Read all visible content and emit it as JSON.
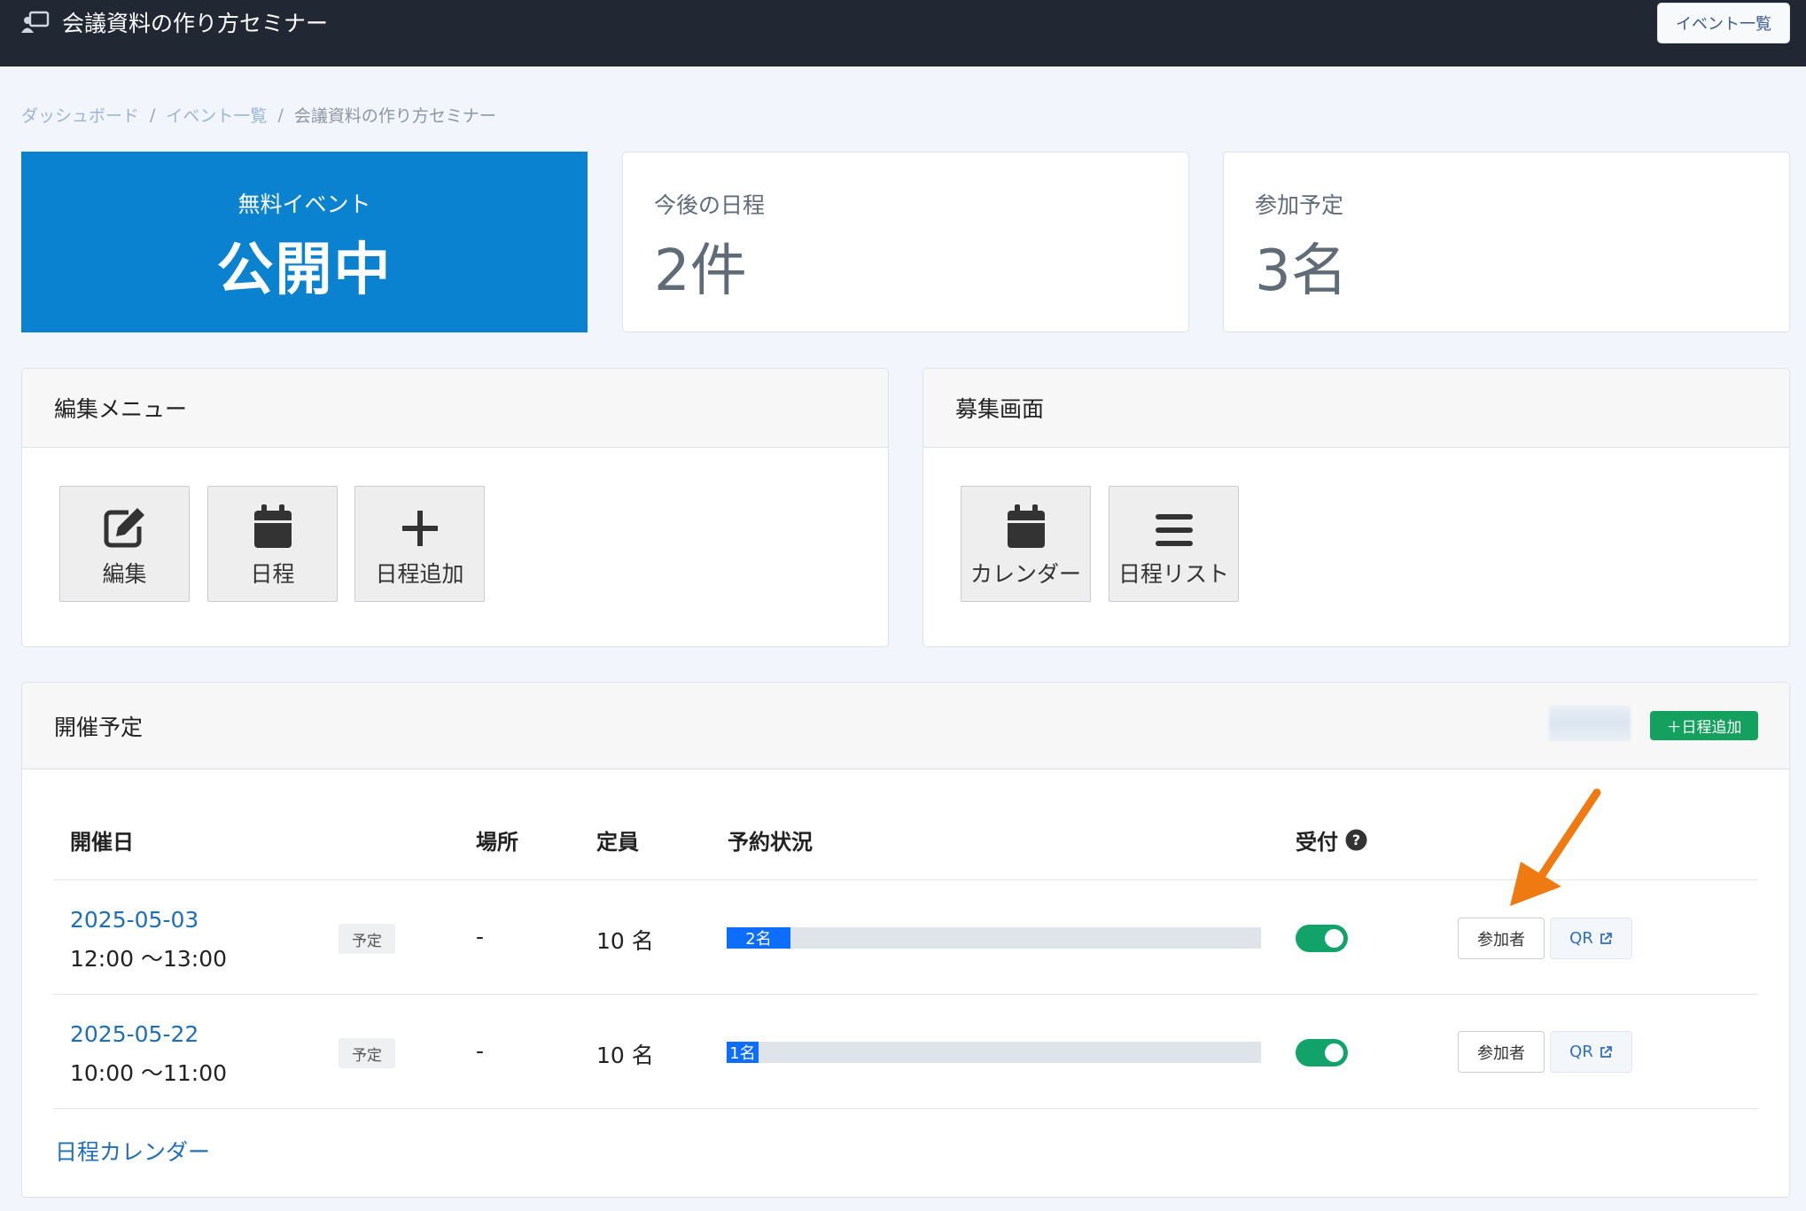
{
  "header": {
    "title": "会議資料の作り方セミナー",
    "events_button": "イベント一覧"
  },
  "breadcrumb": [
    "ダッシュボード",
    "イベント一覧",
    "会議資料の作り方セミナー"
  ],
  "stats": {
    "status_label": "無料イベント",
    "status_value": "公開中",
    "upcoming_label": "今後の日程",
    "upcoming_value": "2件",
    "participants_label": "参加予定",
    "participants_value": "3名"
  },
  "edit_menu": {
    "title": "編集メニュー",
    "items": [
      {
        "label": "編集",
        "icon": "edit-icon"
      },
      {
        "label": "日程",
        "icon": "calendar-icon"
      },
      {
        "label": "日程追加",
        "icon": "plus-icon"
      }
    ]
  },
  "recruit": {
    "title": "募集画面",
    "items": [
      {
        "label": "カレンダー",
        "icon": "calendar-icon"
      },
      {
        "label": "日程リスト",
        "icon": "list-icon"
      }
    ]
  },
  "schedule": {
    "title": "開催予定",
    "add_button": "＋日程追加",
    "columns": {
      "date": "開催日",
      "place": "場所",
      "capacity": "定員",
      "status": "予約状況",
      "reception": "受付"
    },
    "rows": [
      {
        "date": "2025-05-03",
        "time": "12:00 〜13:00",
        "badge": "予定",
        "place": "-",
        "capacity": "10 名",
        "booked_label": "2名",
        "booked_fraction": 0.2,
        "reception_on": true,
        "participants_button": "参加者",
        "qr_button": "QR"
      },
      {
        "date": "2025-05-22",
        "time": "10:00 〜11:00",
        "badge": "予定",
        "place": "-",
        "capacity": "10 名",
        "booked_label": "1名",
        "booked_fraction": 0.1,
        "reception_on": true,
        "participants_button": "参加者",
        "qr_button": "QR"
      }
    ],
    "calendar_link": "日程カレンダー"
  },
  "colors": {
    "topbar": "#212834",
    "primary": "#0a82cf",
    "success": "#14a05f",
    "link": "#1f6fb5",
    "annotation_arrow": "#f07a12"
  }
}
